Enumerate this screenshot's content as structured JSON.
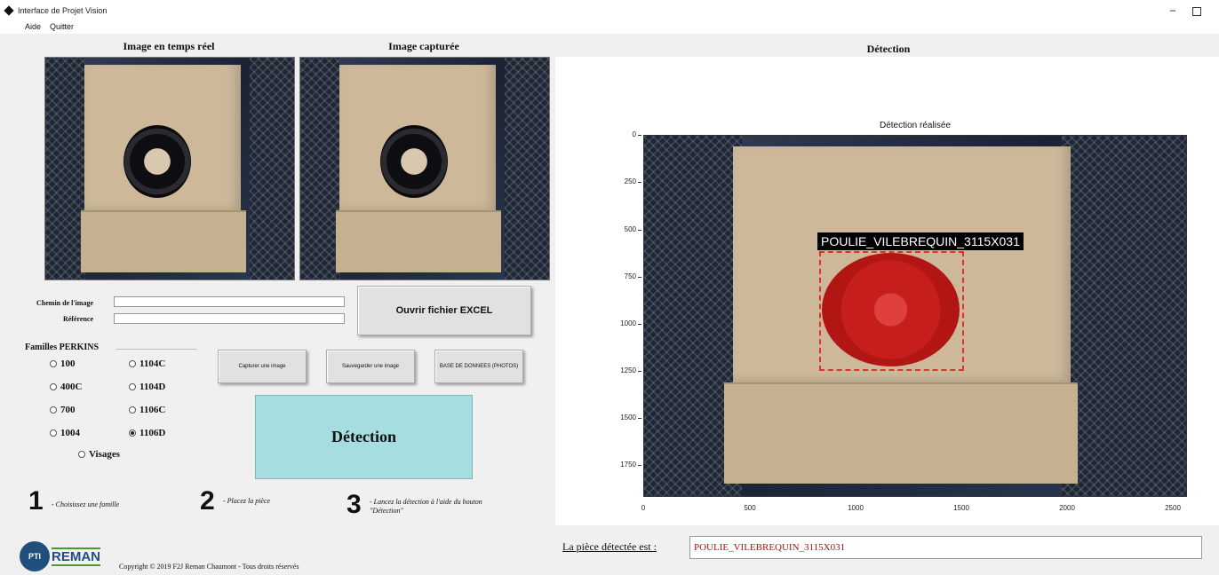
{
  "window": {
    "title": "Interface de Projet Vision",
    "minimize": "–"
  },
  "menu": {
    "items": [
      "Aide",
      "Quitter"
    ]
  },
  "left": {
    "live_heading": "Image en temps réel",
    "captured_heading": "Image capturée",
    "path_label": "Chemin de l'image",
    "path_value": "",
    "ref_label": "Référence",
    "ref_value": "",
    "open_excel": "Ouvrir fichier EXCEL",
    "capture_button": "Capturer une image",
    "save_button": "Sauvegarder une image",
    "database_button": "BASE DE DONNEES (PHOTOS)",
    "families_label": "Familles PERKINS",
    "families": [
      {
        "label": "100",
        "selected": false
      },
      {
        "label": "1104C",
        "selected": false
      },
      {
        "label": "400C",
        "selected": false
      },
      {
        "label": "1104D",
        "selected": false
      },
      {
        "label": "700",
        "selected": false
      },
      {
        "label": "1106C",
        "selected": false
      },
      {
        "label": "1004",
        "selected": false
      },
      {
        "label": "1106D",
        "selected": true
      },
      {
        "label": "Visages",
        "selected": false
      }
    ],
    "detect_button": "Détection",
    "steps": [
      {
        "num": "1",
        "text": "- Choisissez une famille"
      },
      {
        "num": "2",
        "text": "- Placez la pièce"
      },
      {
        "num": "3",
        "text": "- Lancez la détection à l'aide du bouton \"Détection\""
      }
    ]
  },
  "right": {
    "heading": "Détection",
    "plot_title": "Détection réalisée",
    "y_ticks": [
      "0",
      "250",
      "500",
      "750",
      "1000",
      "1250",
      "1500",
      "1750"
    ],
    "x_ticks": [
      "0",
      "500",
      "1000",
      "1500",
      "2000",
      "2500"
    ],
    "detection_label": "POULIE_VILEBREQUIN_3115X031",
    "result_label": "La pièce détectée est :",
    "result_value": "POULIE_VILEBREQUIN_3115X031"
  },
  "footer": {
    "logo_mark": "PTI",
    "logo_text": "REMAN",
    "copyright": "Copyright © 2019 F2J Reman Chaumont - Tous droits réservés"
  },
  "colors": {
    "detect_button": "#a6dde1",
    "detection": "#c51616",
    "brand": "#1f4f7a"
  }
}
